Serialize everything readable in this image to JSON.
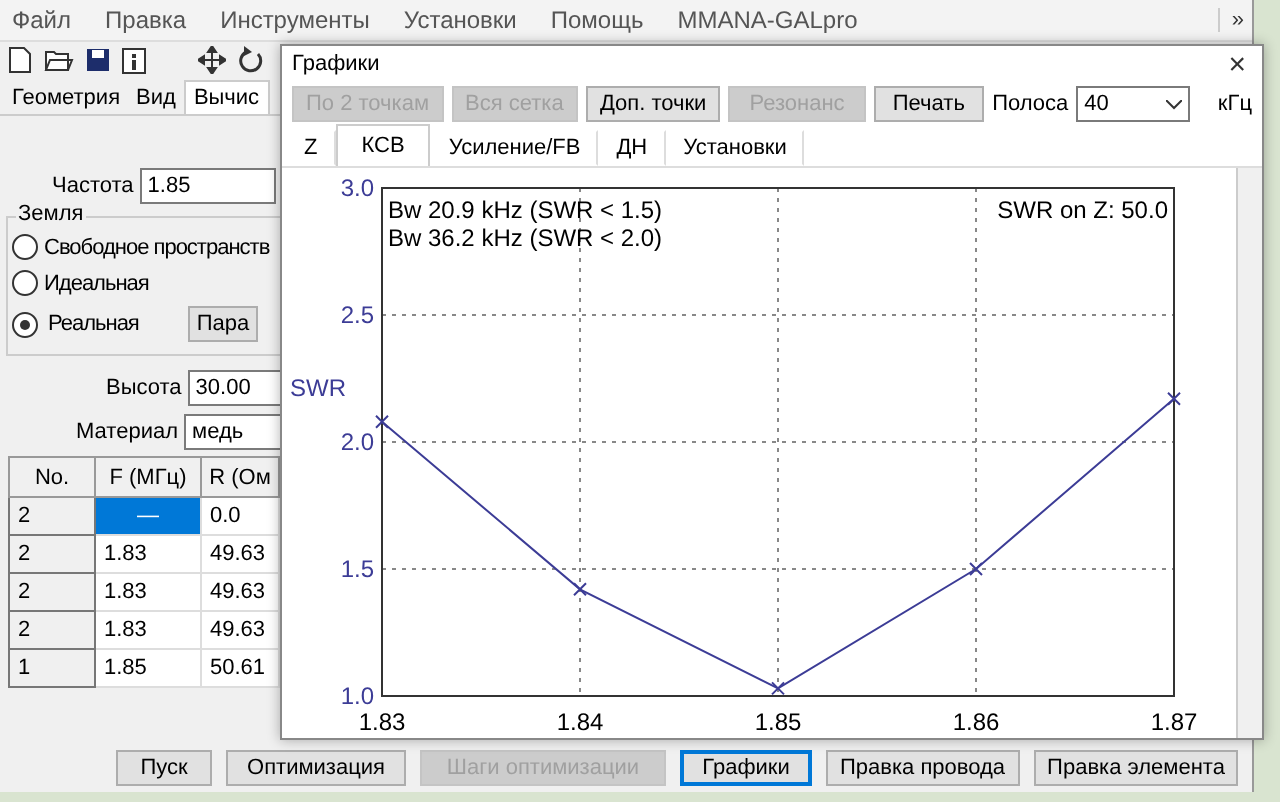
{
  "menu": [
    "Файл",
    "Правка",
    "Инструменты",
    "Установки",
    "Помощь",
    "MMANA-GALpro"
  ],
  "menu_overflow": "»",
  "main_tabs": [
    {
      "label": "Геометрия",
      "selected": false
    },
    {
      "label": "Вид",
      "selected": false
    },
    {
      "label": "Вычис",
      "selected": true
    }
  ],
  "frequency": {
    "label": "Частота",
    "value": "1.85"
  },
  "ground": {
    "title": "Земля",
    "options": [
      {
        "label": "Свободное пространств",
        "selected": false
      },
      {
        "label": "Идеальная",
        "selected": false
      },
      {
        "label": "Реальная",
        "selected": true
      }
    ],
    "button": "Пара"
  },
  "height": {
    "label": "Высота",
    "value": "30.00"
  },
  "material": {
    "label": "Материал",
    "value": "медь"
  },
  "table": {
    "columns": [
      "No.",
      "F (МГц)",
      "R (Ом"
    ],
    "rows": [
      {
        "cells": [
          "2",
          "—",
          "0.0"
        ],
        "selected": true
      },
      {
        "cells": [
          "2",
          "1.83",
          "49.63"
        ],
        "selected": false
      },
      {
        "cells": [
          "2",
          "1.83",
          "49.63"
        ],
        "selected": false
      },
      {
        "cells": [
          "2",
          "1.83",
          "49.63"
        ],
        "selected": false
      },
      {
        "cells": [
          "1",
          "1.85",
          "50.61"
        ],
        "selected": false
      }
    ]
  },
  "bottom_buttons": [
    {
      "label": "Пуск",
      "disabled": false,
      "focused": false
    },
    {
      "label": "Оптимизация",
      "disabled": false,
      "focused": false
    },
    {
      "label": "Шаги оптимизации",
      "disabled": true,
      "focused": false
    },
    {
      "label": "Графики",
      "disabled": false,
      "focused": true
    },
    {
      "label": "Правка провода",
      "disabled": false,
      "focused": false
    },
    {
      "label": "Правка элемента",
      "disabled": false,
      "focused": false
    }
  ],
  "dialog": {
    "title": "Графики",
    "close": "×",
    "buttons": [
      {
        "label": "По 2 точкам",
        "disabled": true
      },
      {
        "label": "Вся сетка",
        "disabled": true
      },
      {
        "label": "Доп. точки",
        "disabled": false
      },
      {
        "label": "Резонанс",
        "disabled": true
      },
      {
        "label": "Печать",
        "disabled": false
      }
    ],
    "band": {
      "label": "Полоса",
      "value": "40",
      "unit": "кГц"
    },
    "tabs": [
      {
        "label": "Z",
        "selected": false
      },
      {
        "label": "КСВ",
        "selected": true
      },
      {
        "label": "Усиление/FB",
        "selected": false
      },
      {
        "label": "ДН",
        "selected": false
      },
      {
        "label": "Установки",
        "selected": false
      }
    ],
    "chart_data": {
      "type": "line",
      "ylabel": "SWR",
      "x": [
        1.83,
        1.84,
        1.85,
        1.86,
        1.87
      ],
      "grid": true,
      "series": [
        {
          "color": "#3c3c96",
          "marker": "x",
          "values": [
            2.08,
            1.42,
            1.03,
            1.5,
            2.17
          ]
        }
      ],
      "xlim": [
        1.83,
        1.87
      ],
      "ylim": [
        1.0,
        3.0
      ],
      "xticks": [
        {
          "value": 1.83,
          "label": "1.83"
        },
        {
          "value": 1.84,
          "label": "1.84"
        },
        {
          "value": 1.85,
          "label": "1.85"
        },
        {
          "value": 1.86,
          "label": "1.86"
        },
        {
          "value": 1.87,
          "label": "1.87"
        }
      ],
      "yticks": [
        {
          "value": 1.0,
          "label": "1.0"
        },
        {
          "value": 1.5,
          "label": "1.5"
        },
        {
          "value": 2.0,
          "label": "2.0"
        },
        {
          "value": 2.5,
          "label": "2.5"
        },
        {
          "value": 3.0,
          "label": "3.0"
        }
      ],
      "annotations": [
        "Bw 20.9 kHz (SWR < 1.5)",
        "Bw 36.2 kHz (SWR < 2.0)",
        "SWR on Z: 50.0"
      ]
    }
  }
}
